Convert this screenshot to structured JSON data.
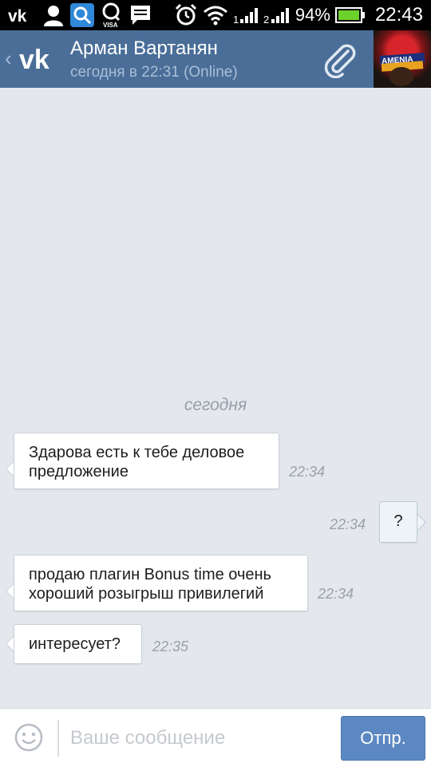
{
  "status_bar": {
    "battery": "94%",
    "time": "22:43",
    "icons": [
      "vk-icon",
      "contacts-icon",
      "search-app-icon",
      "qiwi-icon",
      "message-icon",
      "alarm-icon",
      "wifi-icon",
      "signal-1-icon",
      "signal-2-icon",
      "battery-icon"
    ],
    "qiwi_sub": "VISA"
  },
  "header": {
    "contact_name": "Арман Вартанян",
    "contact_status": "сегодня в 22:31 (Online)",
    "avatar_text": "AMENIA"
  },
  "chat": {
    "day_separator": "сегодня",
    "messages": [
      {
        "direction": "in",
        "lines": [
          "Здарова есть к тебе деловое",
          "предложение"
        ],
        "time": "22:34"
      },
      {
        "direction": "out",
        "lines": [
          "?"
        ],
        "time": "22:34"
      },
      {
        "direction": "in",
        "lines": [
          "продаю плагин Bonus time очень",
          "хороший розыгрыш привилегий"
        ],
        "time": "22:34"
      },
      {
        "direction": "in",
        "lines": [
          "интересует?"
        ],
        "time": "22:35"
      }
    ]
  },
  "composer": {
    "placeholder": "Ваше сообщение",
    "value": "",
    "send_label": "Отпр."
  },
  "colors": {
    "header_bg": "#4a6e98",
    "chat_bg": "#e4e8ed",
    "send_button": "#5b88c2",
    "battery_fill": "#6cd12b"
  }
}
